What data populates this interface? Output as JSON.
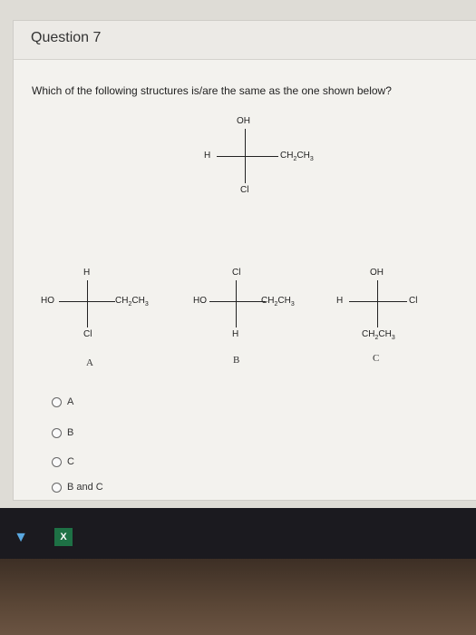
{
  "question": {
    "title": "Question 7",
    "text": "Which of the following structures is/are the same as the one shown below?"
  },
  "reference": {
    "top": "OH",
    "left": "H",
    "right": "CH2CH3",
    "bottom": "Cl"
  },
  "options": [
    {
      "letter": "A",
      "top": "H",
      "left": "HO",
      "right": "CH2CH3",
      "bottom": "Cl"
    },
    {
      "letter": "B",
      "top": "Cl",
      "left": "HO",
      "right": "CH2CH3",
      "bottom": "H"
    },
    {
      "letter": "C",
      "top": "OH",
      "left": "H",
      "right": "Cl",
      "bottom": "CH2CH3"
    }
  ],
  "choices": [
    {
      "label": "A"
    },
    {
      "label": "B"
    },
    {
      "label": "C"
    },
    {
      "label": "B and C"
    }
  ],
  "taskbar": {
    "app1_icon": "vlc-cone-icon",
    "app2_icon": "excel-icon",
    "app2_glyph": "X"
  }
}
